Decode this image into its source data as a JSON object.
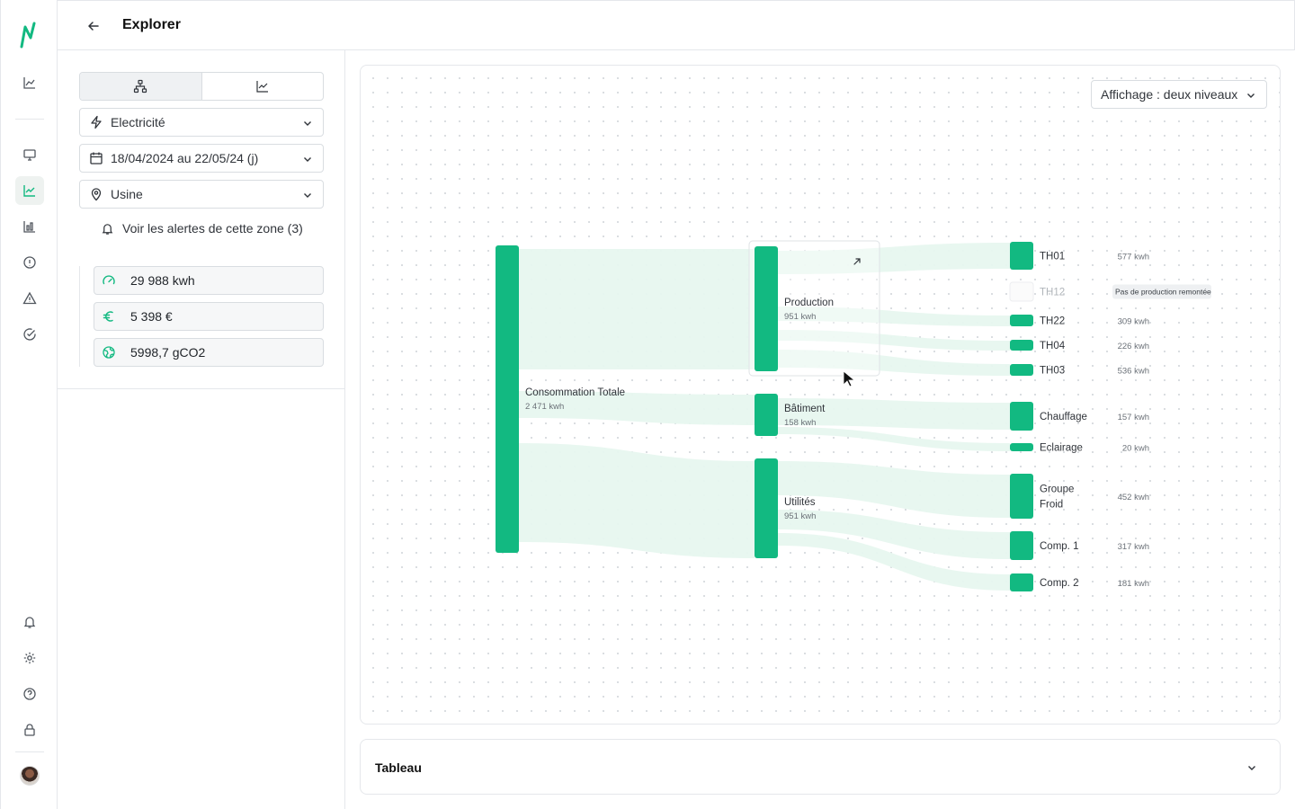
{
  "header": {
    "title": "Explorer"
  },
  "panel": {
    "energy_select": "Electricité",
    "date_select": "18/04/2024 au 22/05/24 (j)",
    "zone_select": "Usine",
    "alerts_link": "Voir les alertes de cette zone (3)",
    "kpis": [
      {
        "icon": "gauge-icon",
        "value": "29 988 kwh"
      },
      {
        "icon": "euro-icon",
        "value": "5 398 €"
      },
      {
        "icon": "globe-icon",
        "value": "5998,7 gCO2"
      }
    ]
  },
  "chart": {
    "display_select": "Affichage : deux niveaux",
    "expand_icon": "arrow-up-right-icon",
    "accent_color": "#12b981",
    "flow_color": "#e7f7ef"
  },
  "chart_data": {
    "type": "sankey",
    "unit": "kwh",
    "nodes": [
      {
        "id": "total",
        "label": "Consommation Totale",
        "value_label": "2 471 kwh",
        "level": 0
      },
      {
        "id": "production",
        "label": "Production",
        "value_label": "951 kwh",
        "level": 1
      },
      {
        "id": "batiment",
        "label": "Bâtiment",
        "value_label": "158 kwh",
        "level": 1
      },
      {
        "id": "utilites",
        "label": "Utilités",
        "value_label": "951 kwh",
        "level": 1
      },
      {
        "id": "th01",
        "label": "TH01",
        "value_label": "577 kwh",
        "level": 2
      },
      {
        "id": "th12",
        "label": "TH12",
        "value_label": "Pas de production remontée",
        "level": 2,
        "no_data": true
      },
      {
        "id": "th22",
        "label": "TH22",
        "value_label": "309 kwh",
        "level": 2
      },
      {
        "id": "th04",
        "label": "TH04",
        "value_label": "226 kwh",
        "level": 2
      },
      {
        "id": "th03",
        "label": "TH03",
        "value_label": "536 kwh",
        "level": 2
      },
      {
        "id": "chauffage",
        "label": "Chauffage",
        "value_label": "157 kwh",
        "level": 2
      },
      {
        "id": "eclairage",
        "label": "Eclairage",
        "value_label": "20 kwh",
        "level": 2
      },
      {
        "id": "groupe_froid",
        "label": "Groupe Froid",
        "label_lines": [
          "Groupe",
          "Froid"
        ],
        "value_label": "452 kwh",
        "level": 2
      },
      {
        "id": "comp1",
        "label": "Comp. 1",
        "value_label": "317 kwh",
        "level": 2
      },
      {
        "id": "comp2",
        "label": "Comp. 2",
        "value_label": "181 kwh",
        "level": 2
      }
    ],
    "links": [
      {
        "source": "total",
        "target": "production",
        "value": 951
      },
      {
        "source": "total",
        "target": "batiment",
        "value": 158
      },
      {
        "source": "total",
        "target": "utilites",
        "value": 951
      },
      {
        "source": "production",
        "target": "th01",
        "value": 577
      },
      {
        "source": "production",
        "target": "th22",
        "value": 309
      },
      {
        "source": "production",
        "target": "th04",
        "value": 226
      },
      {
        "source": "production",
        "target": "th03",
        "value": 536
      },
      {
        "source": "batiment",
        "target": "chauffage",
        "value": 157
      },
      {
        "source": "batiment",
        "target": "eclairage",
        "value": 20
      },
      {
        "source": "utilites",
        "target": "groupe_froid",
        "value": 452
      },
      {
        "source": "utilites",
        "target": "comp1",
        "value": 317
      },
      {
        "source": "utilites",
        "target": "comp2",
        "value": 181
      }
    ]
  },
  "tableau": {
    "label": "Tableau"
  }
}
